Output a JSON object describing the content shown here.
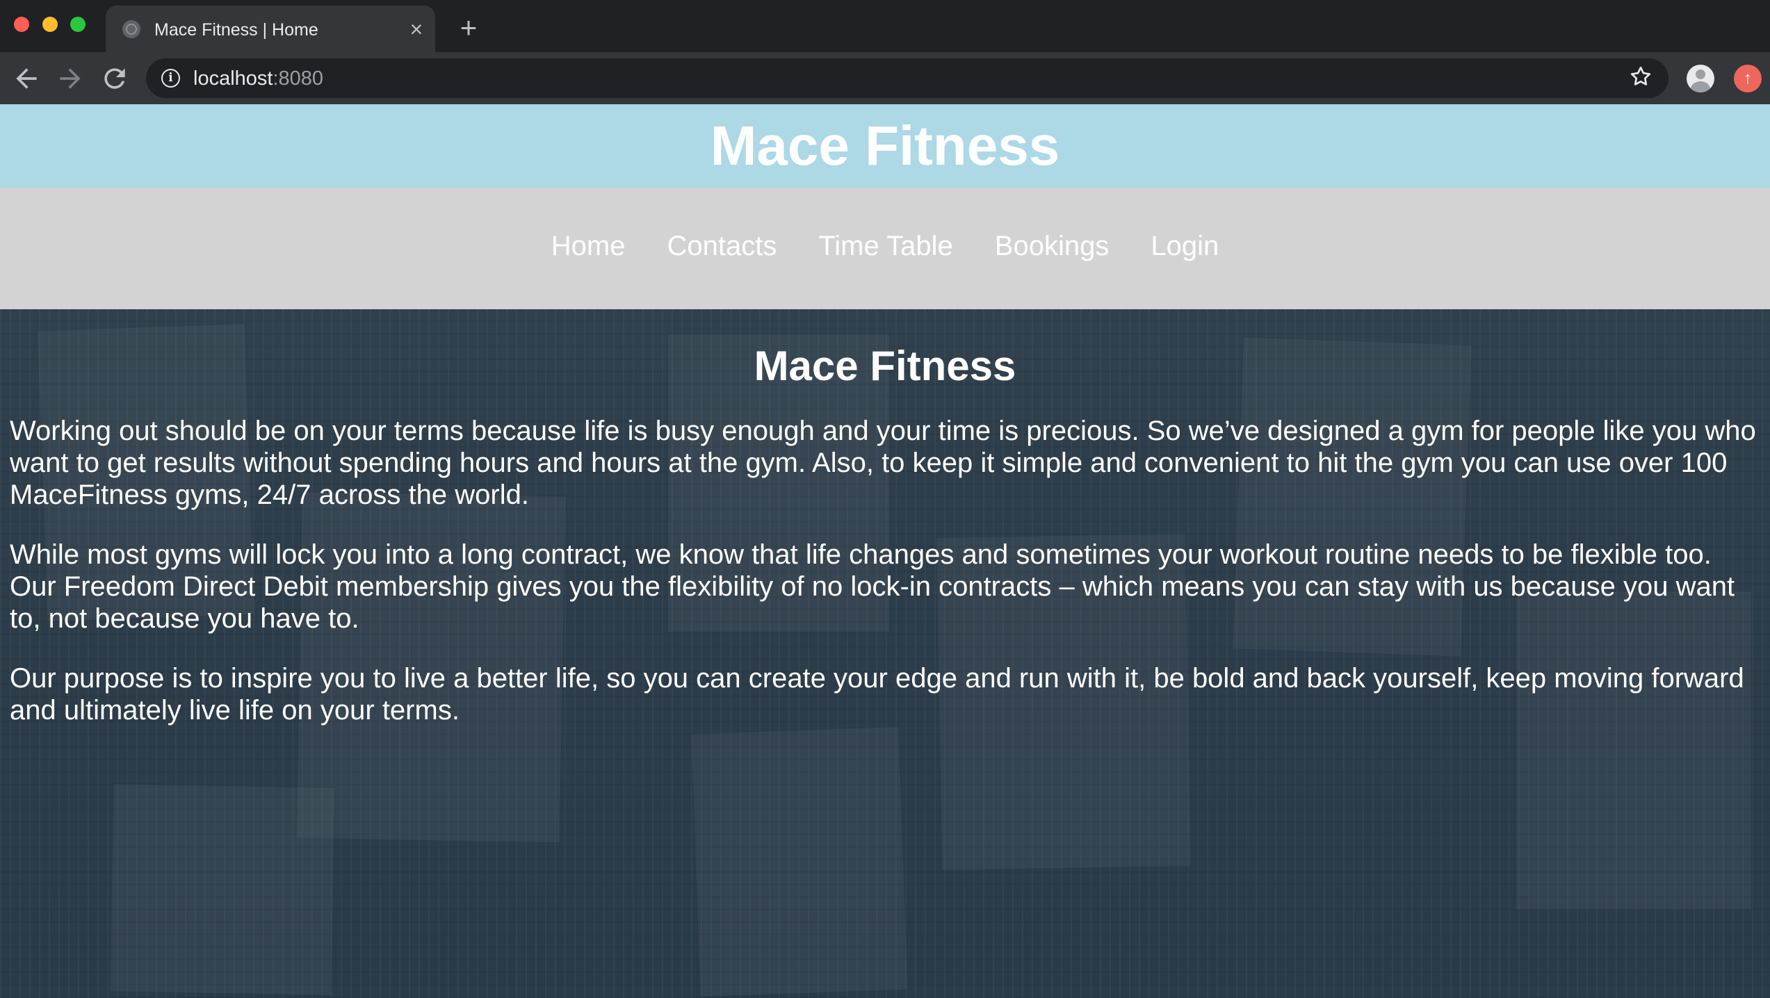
{
  "browser": {
    "tab": {
      "title": "Mace Fitness | Home"
    },
    "address_bar": {
      "host": "localhost",
      "port": ":8080"
    },
    "icons": {
      "back": "arrow-left-icon",
      "forward": "arrow-right-icon",
      "reload": "reload-icon",
      "info": "info-icon",
      "bookmark": "star-icon",
      "profile": "profile-icon",
      "update": "update-icon",
      "close_tab": "close-icon",
      "new_tab": "plus-icon"
    }
  },
  "site": {
    "header": {
      "title": "Mace Fitness",
      "background": "#add8e6"
    },
    "nav": {
      "background": "#d3d3d3",
      "items": [
        {
          "label": "Home"
        },
        {
          "label": "Contacts"
        },
        {
          "label": "Time Table"
        },
        {
          "label": "Bookings"
        },
        {
          "label": "Login"
        }
      ]
    },
    "main": {
      "heading": "Mace Fitness",
      "paragraphs": [
        "Working out should be on your terms because life is busy enough and your time is precious. So we’ve designed a gym for people like you who want to get results without spending hours and hours at the gym. Also, to keep it simple and convenient to hit the gym you can use over 100 MaceFitness gyms, 24/7 across the world.",
        "While most gyms will lock you into a long contract, we know that life changes and sometimes your workout routine needs to be flexible too. Our Freedom Direct Debit membership gives you the flexibility of no lock-in contracts – which means you can stay with us because you want to, not because you have to.",
        "Our purpose is to inspire you to live a better life, so you can create your edge and run with it, be bold and back yourself, keep moving forward and ultimately live life on your terms."
      ]
    }
  }
}
